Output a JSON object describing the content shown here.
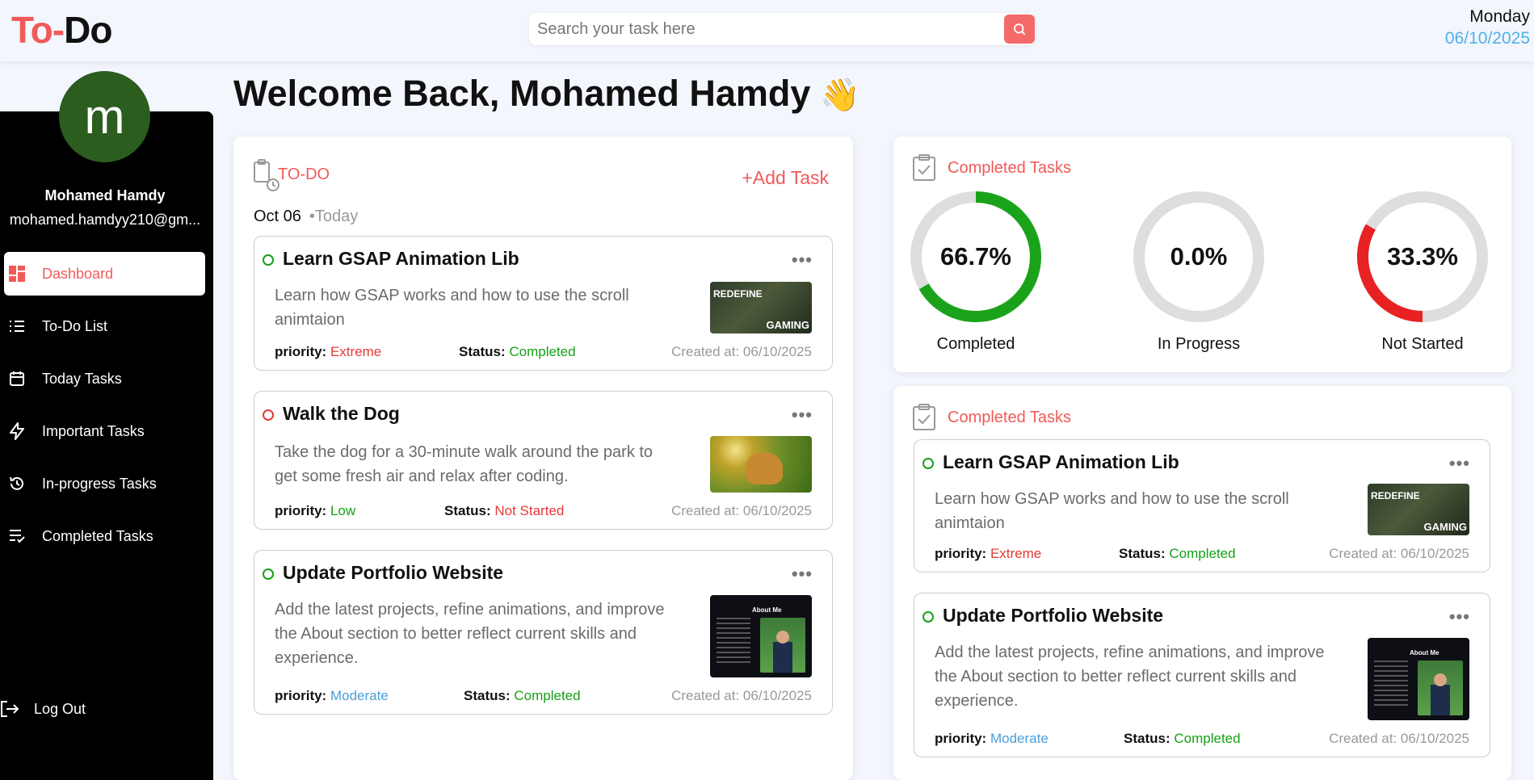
{
  "header": {
    "logo_part1": "To-",
    "logo_part2": "Do",
    "search_placeholder": "Search your task here",
    "day": "Monday",
    "date": "06/10/2025"
  },
  "sidebar": {
    "avatar_letter": "m",
    "user_name": "Mohamed Hamdy",
    "user_email": "mohamed.hamdyy210@gm...",
    "items": [
      {
        "label": "Dashboard",
        "icon": "dashboard-icon",
        "active": true
      },
      {
        "label": "To-Do List",
        "icon": "list-icon",
        "active": false
      },
      {
        "label": "Today Tasks",
        "icon": "calendar-icon",
        "active": false
      },
      {
        "label": "Important Tasks",
        "icon": "lightning-icon",
        "active": false
      },
      {
        "label": "In-progress Tasks",
        "icon": "history-icon",
        "active": false
      },
      {
        "label": "Completed Tasks",
        "icon": "checklist-icon",
        "active": false
      }
    ],
    "logout_label": "Log Out"
  },
  "welcome": {
    "text": "Welcome Back, Mohamed Hamdy",
    "emoji": "👋"
  },
  "todo": {
    "heading": "TO-DO",
    "add_task": "+Add Task",
    "date": "Oct 06",
    "today": "•Today",
    "tasks": [
      {
        "title": "Learn GSAP Animation Lib",
        "description": "Learn how GSAP works and how to use the scroll animtaion",
        "priority_label": "priority:",
        "priority": "Extreme",
        "status_label": "Status:",
        "status": "Completed",
        "created": "Created at: 06/10/2025",
        "thumb_text_top": "REDEFINE",
        "thumb_text_bottom": "GAMING"
      },
      {
        "title": "Walk the Dog",
        "description": "Take the dog for a 30-minute walk around the park to get some fresh air and relax after coding.",
        "priority_label": "priority:",
        "priority": "Low",
        "status_label": "Status:",
        "status": "Not Started",
        "created": "Created at: 06/10/2025"
      },
      {
        "title": "Update Portfolio Website",
        "description": "Add the latest projects, refine animations, and improve the About section to better reflect current skills and experience.",
        "priority_label": "priority:",
        "priority": "Moderate",
        "status_label": "Status:",
        "status": "Completed",
        "created": "Created at: 06/10/2025",
        "thumb_text": "About Me"
      }
    ]
  },
  "stats": {
    "heading": "Completed Tasks",
    "rings": [
      {
        "value": "66.7%",
        "fraction": 0.667,
        "label": "Completed",
        "color": "#1aa31a"
      },
      {
        "value": "0.0%",
        "fraction": 0.0,
        "label": "In Progress",
        "color": "#4a9fd6"
      },
      {
        "value": "33.3%",
        "fraction": 0.333,
        "label": "Not Started",
        "color": "#e82222"
      }
    ]
  },
  "completed": {
    "heading": "Completed Tasks",
    "tasks": [
      {
        "title": "Learn GSAP Animation Lib",
        "description": "Learn how GSAP works and how to use the scroll animtaion",
        "priority_label": "priority:",
        "priority": "Extreme",
        "status_label": "Status:",
        "status": "Completed",
        "created": "Created at: 06/10/2025",
        "thumb_text_top": "REDEFINE",
        "thumb_text_bottom": "GAMING"
      },
      {
        "title": "Update Portfolio Website",
        "description": "Add the latest projects, refine animations, and improve the About section to better reflect current skills and experience.",
        "priority_label": "priority:",
        "priority": "Moderate",
        "status_label": "Status:",
        "status": "Completed",
        "created": "Created at: 06/10/2025",
        "thumb_text": "About Me"
      }
    ]
  },
  "colors": {
    "accent": "#f15a5a",
    "completed": "#16a016",
    "not_started": "#e53935",
    "moderate": "#4a9fd6",
    "date_blue": "#4fb0ea"
  }
}
